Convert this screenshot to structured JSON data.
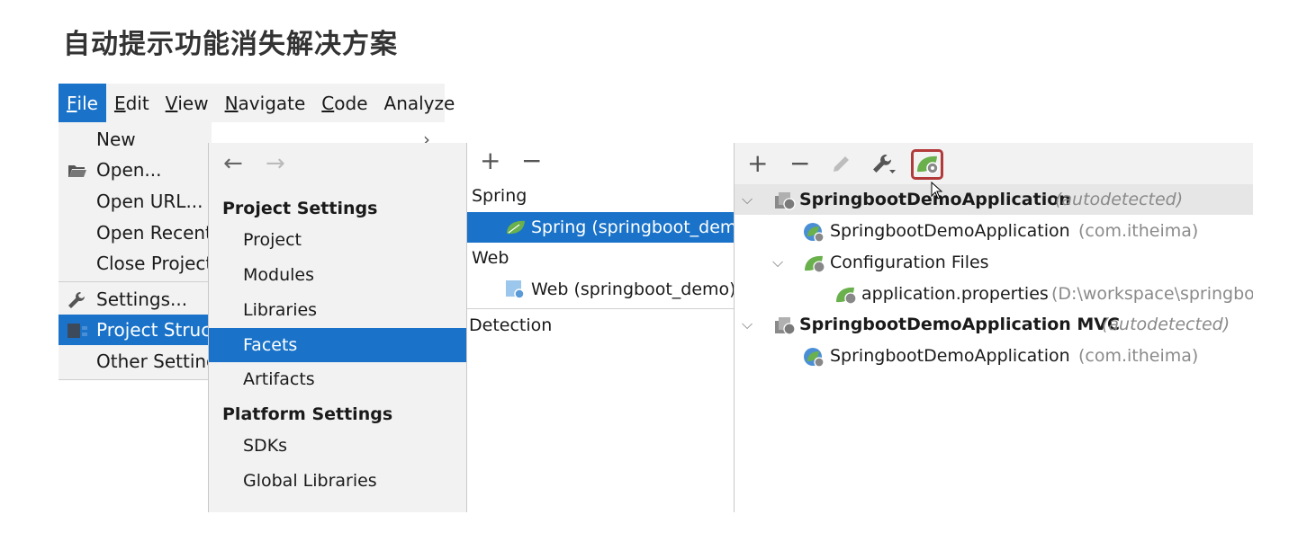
{
  "title": "自动提示功能消失解决方案",
  "menubar": {
    "items": [
      {
        "mnemonic": "F",
        "rest": "ile",
        "active": true
      },
      {
        "mnemonic": "E",
        "rest": "dit"
      },
      {
        "mnemonic": "V",
        "rest": "iew"
      },
      {
        "mnemonic": "N",
        "rest": "avigate"
      },
      {
        "mnemonic": "C",
        "rest": "ode"
      },
      {
        "mnemonic": "",
        "rest": "Analyze"
      }
    ]
  },
  "file_menu": {
    "new": "New",
    "open": "Open...",
    "open_url": "Open URL...",
    "open_recent": "Open Recent",
    "close_project": "Close Project",
    "settings": "Settings...",
    "project_structure": "Project Struct",
    "other_settings": "Other Setting",
    "submenu_arrow": "›"
  },
  "sidebar": {
    "back_arrow": "←",
    "forward_arrow": "→",
    "project_settings": "Project Settings",
    "project_items": [
      "Project",
      "Modules",
      "Libraries",
      "Facets",
      "Artifacts"
    ],
    "selected": "Facets",
    "platform_settings": "Platform Settings",
    "platform_items": [
      "SDKs",
      "Global Libraries"
    ]
  },
  "facets_panel": {
    "add": "+",
    "remove": "−",
    "spring_group": "Spring",
    "spring_item": "Spring (springboot_dem",
    "web_group": "Web",
    "web_item": "Web (springboot_demo)",
    "detection": "Detection"
  },
  "details_panel": {
    "add": "+",
    "remove": "−",
    "tree": {
      "ctx1_name": "SpringbootDemoApplication",
      "ctx1_tag": "(autodetected)",
      "ctx1_child": "SpringbootDemoApplication",
      "ctx1_child_pkg": "(com.itheima)",
      "config_files": "Configuration Files",
      "app_props": "application.properties",
      "app_props_path": "(D:\\workspace\\springbo",
      "ctx2_name": "SpringbootDemoApplication MVC",
      "ctx2_tag": "(autodetected)",
      "ctx2_child": "SpringbootDemoApplication",
      "ctx2_child_pkg": "(com.itheima)"
    }
  },
  "colors": {
    "selection": "#1a73c9",
    "spring_green": "#6ab04c",
    "highlight_box": "#b23a3a"
  }
}
